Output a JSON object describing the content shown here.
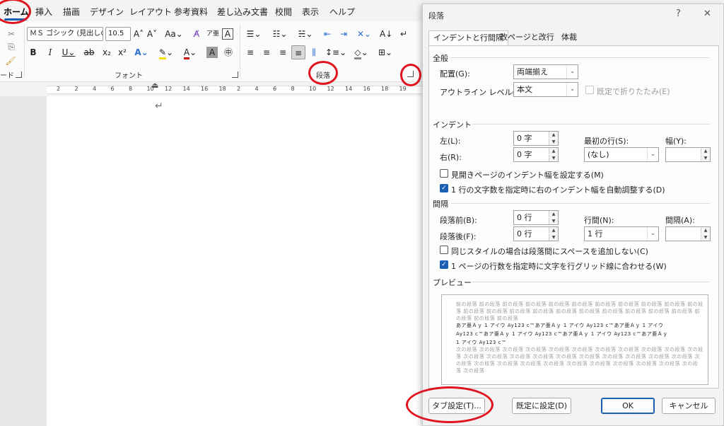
{
  "word": {
    "tabs": [
      "ホーム",
      "挿入",
      "描画",
      "デザイン",
      "レイアウト",
      "参考資料",
      "差し込み文書",
      "校閲",
      "表示",
      "ヘルプ"
    ],
    "font": {
      "name": "ＭＳ ゴシック (見出しの",
      "size": "10.5"
    },
    "groups": {
      "clipboard_tail": "ード",
      "font": "フォント",
      "paragraph": "段落"
    },
    "ruler_numbers": [
      "2",
      "2",
      "4",
      "6",
      "8",
      "10",
      "12",
      "14",
      "16",
      "18",
      "2",
      "4",
      "6",
      "8",
      "10",
      "12",
      "14",
      "16",
      "18",
      "19"
    ],
    "paragraph_mark": "↵"
  },
  "dialog": {
    "title": "段落",
    "help": "?",
    "close": "✕",
    "tabs": [
      "インデントと行間隔",
      "改ページと改行",
      "体裁"
    ],
    "general": {
      "heading": "全般",
      "alignment_label": "配置(G):",
      "alignment_value": "両端揃え",
      "outline_label": "アウトライン レベル(O):",
      "outline_value": "本文",
      "collapse_label": "既定で折りたたみ(E)"
    },
    "indent": {
      "heading": "インデント",
      "left_label": "左(L):",
      "left_value": "0 字",
      "right_label": "右(R):",
      "right_value": "0 字",
      "first_line_label": "最初の行(S):",
      "first_line_value": "(なし)",
      "width_label": "幅(Y):",
      "width_value": "",
      "mirror_label": "見開きページのインデント幅を設定する(M)",
      "auto_adjust_label": "1 行の文字数を指定時に右のインデント幅を自動調整する(D)"
    },
    "spacing": {
      "heading": "間隔",
      "before_label": "段落前(B):",
      "before_value": "0 行",
      "after_label": "段落後(F):",
      "after_value": "0 行",
      "line_label": "行間(N):",
      "line_value": "1 行",
      "at_label": "間隔(A):",
      "at_value": "",
      "no_space_label": "同じスタイルの場合は段落間にスペースを追加しない(C)",
      "snap_grid_label": "1 ページの行数を指定時に文字を行グリッド線に合わせる(W)"
    },
    "preview": {
      "heading": "プレビュー",
      "prev_lines": [
        "前の段落 前の段落 前の段落 前の段落 前の段落 前の段落 前の段落 前の段落 前の段落 前の段落 前の段",
        "落 前の段落 前の段落 前の段落 前の段落 前の段落 前の段落 前の段落 前の段落 前の段落 前の段落 前",
        "の段落 前の段落 前の段落"
      ],
      "sample_lines": [
        "あア亜Ａｙ 1 アイウ Ay123 c™あア亜Ａｙ 1 アイウ Ay123 c™あア亜Ａｙ 1 アイウ",
        "Ay123 c™あア亜Ａｙ 1 アイウ Ay123 c™あア亜Ａｙ 1 アイウ Ay123 c™あア亜Ａｙ",
        "1 アイウ Ay123 c™"
      ],
      "next_lines": [
        "次の段落 次の段落 次の段落 次の段落 次の段落 次の段落 次の段落 次の段落 次の段落 次の段落 次の段",
        "落 次の段落 次の段落 次の段落 次の段落 次の段落 次の段落 次の段落 次の段落 次の段落 次の段落 次",
        "の段落 次の段落 次の段落 次の段落 次の段落 次の段落 次の段落 次の段落 次の段落 次の段落 次の段",
        "落 次の段落"
      ]
    },
    "buttons": {
      "tabs": "タブ設定(T)...",
      "set_default": "既定に設定(D)",
      "ok": "OK",
      "cancel": "キャンセル"
    }
  },
  "colors": {
    "accent": "#1a5fb4",
    "annotation": "#e0141e"
  }
}
